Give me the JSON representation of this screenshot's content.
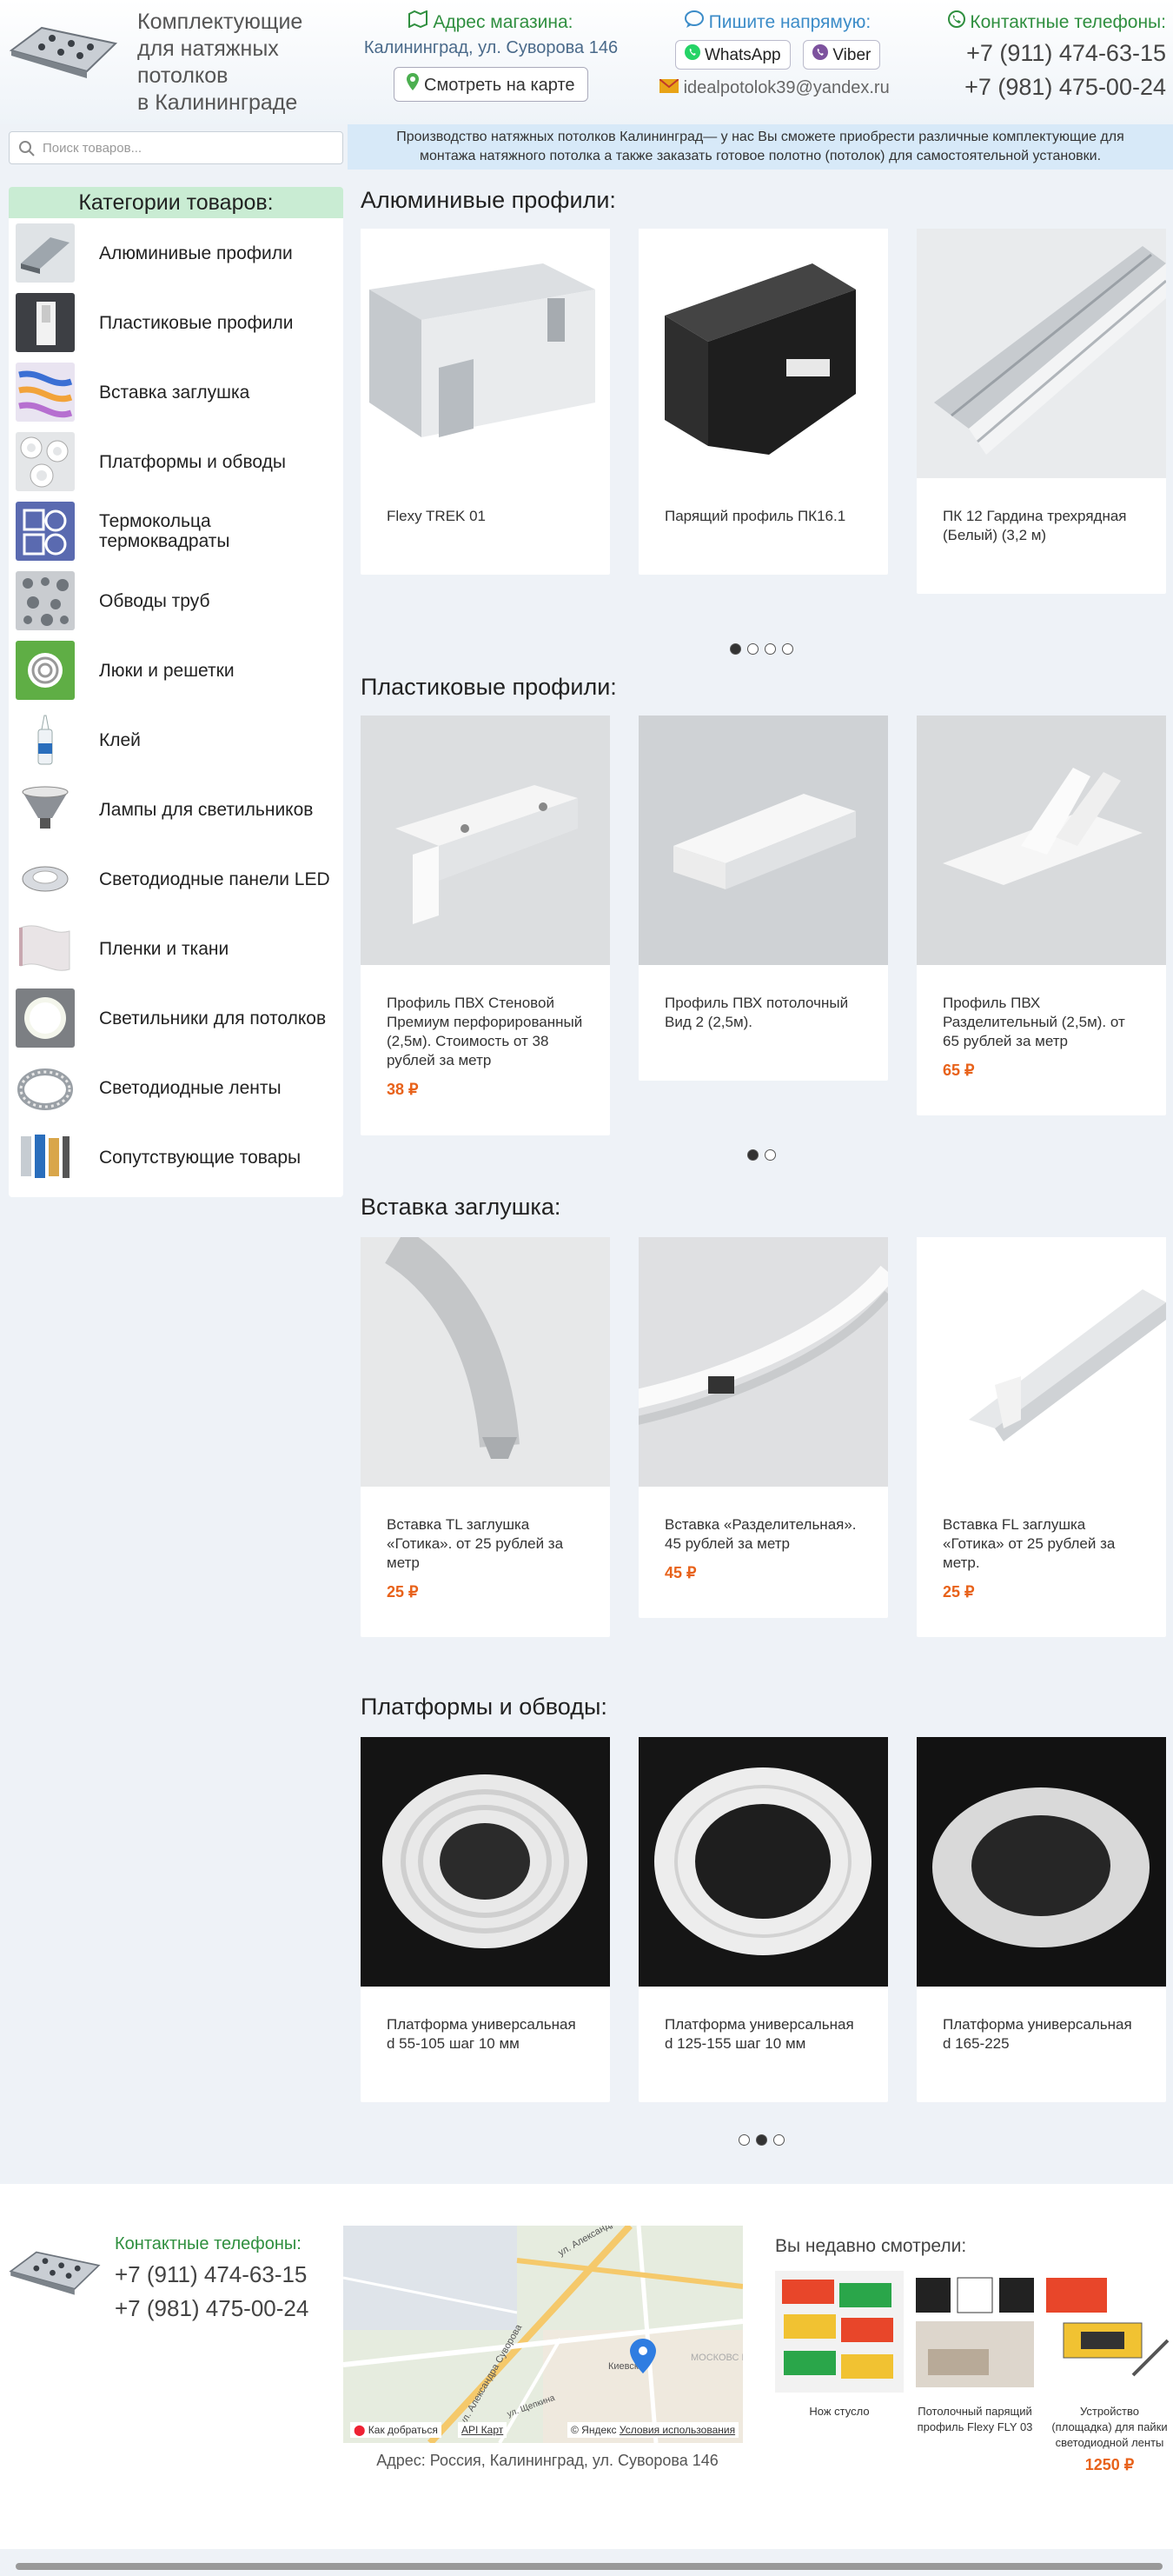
{
  "header": {
    "brand": [
      "Комплектующие",
      "для натяжных",
      "потолков",
      "в Калининграде"
    ],
    "address_title": "Адрес магазина:",
    "address": "Калининград, ул. Суворова 146",
    "map_button": "Смотреть на карте",
    "write_title": "Пишите напрямую:",
    "whatsapp": "WhatsApp",
    "viber": "Viber",
    "email": "idealpotolok39@yandex.ru",
    "phones_title": "Контактные телефоны:",
    "phones": [
      "+7 (911) 474-63-15",
      "+7 (981) 475-00-24"
    ]
  },
  "search": {
    "placeholder": "Поиск товаров..."
  },
  "notice": "Производство натяжных потолков Калининград— у нас Вы сможете приобрести различные комплектующие для монтажа натяжного потолка а также заказать готовое полотно (потолок) для самостоятельной установки.",
  "sidebar": {
    "title": "Категории товаров:",
    "items": [
      {
        "label": "Алюминивые профили",
        "icon": "aluminum-profile"
      },
      {
        "label": "Пластиковые профили",
        "icon": "plastic-profile"
      },
      {
        "label": "Вставка заглушка",
        "icon": "insert-plug"
      },
      {
        "label": "Платформы и обводы",
        "icon": "platforms"
      },
      {
        "label": "Термокольца термоквадраты",
        "icon": "thermo-rings"
      },
      {
        "label": "Обводы труб",
        "icon": "pipe-bypass"
      },
      {
        "label": "Люки и решетки",
        "icon": "hatches"
      },
      {
        "label": "Клей",
        "icon": "glue"
      },
      {
        "label": "Лампы для светильников",
        "icon": "lamps"
      },
      {
        "label": "Светодиодные панели LED",
        "icon": "led-panels"
      },
      {
        "label": "Пленки и ткани",
        "icon": "films"
      },
      {
        "label": "Светильники для потолков",
        "icon": "ceiling-lights"
      },
      {
        "label": "Светодиодные ленты",
        "icon": "led-strips"
      },
      {
        "label": "Сопутствующие товары",
        "icon": "accessories"
      }
    ]
  },
  "sections": [
    {
      "title": "Алюминивые профили:",
      "products": [
        {
          "name": "Flexy TREK 01",
          "price": ""
        },
        {
          "name": "Парящий профиль ПК16.1",
          "price": ""
        },
        {
          "name": "ПК 12 Гардина трехрядная (Белый) (3,2 м)",
          "price": ""
        }
      ],
      "pages": 4,
      "active_page": 1
    },
    {
      "title": "Пластиковые профили:",
      "products": [
        {
          "name": "Профиль ПВХ Стеновой Премиум перфорированный (2,5м). Стоимость от 38 рублей за метр",
          "price": "38 ₽"
        },
        {
          "name": "Профиль ПВХ потолочный Вид 2 (2,5м).",
          "price": ""
        },
        {
          "name": "Профиль ПВХ Разделительный (2,5м). от 65 рублей за метр",
          "price": "65 ₽"
        }
      ],
      "pages": 2,
      "active_page": 1
    },
    {
      "title": "Вставка заглушка:",
      "products": [
        {
          "name": "Вставка TL заглушка «Готика». от 25 рублей за метр",
          "price": "25 ₽"
        },
        {
          "name": "Вставка «Разделительная». 45 рублей за метр",
          "price": "45 ₽"
        },
        {
          "name": "Вставка FL заглушка «Готика» от 25 рублей за метр.",
          "price": "25 ₽"
        }
      ],
      "pages": 0,
      "active_page": 0
    },
    {
      "title": "Платформы и обводы:",
      "products": [
        {
          "name": "Платформа универсальная d 55-105 шаг 10 мм",
          "price": ""
        },
        {
          "name": "Платформа универсальная d 125-155 шаг 10 мм",
          "price": ""
        },
        {
          "name": "Платформа универсальная d 165-225",
          "price": ""
        }
      ],
      "pages": 3,
      "active_page": 2
    }
  ],
  "footer": {
    "phones_title": "Контактные телефоны:",
    "phones": [
      "+7 (911) 474-63-15",
      "+7 (981) 475-00-24"
    ],
    "map_route": "Как добраться",
    "map_api": "API Карт",
    "map_copyright": "© Яндекс",
    "map_terms": "Условия использования",
    "map_labels": [
      "ул. Александра Суворова",
      "ул. Александра Суворова",
      "Киевск.",
      "МОСКОВС РАЙОН",
      "ул. Щепкина"
    ],
    "address": "Адрес: Россия, Калининград, ул. Суворова 146",
    "recent_title": "Вы недавно смотрели:",
    "recent": [
      {
        "name": "Нож стусло",
        "price": ""
      },
      {
        "name": "Потолочный парящий профиль Flexy FLY 03",
        "price": ""
      },
      {
        "name": "Устройство (площадка) для пайки светодиодной ленты",
        "price": "1250 ₽"
      }
    ]
  }
}
